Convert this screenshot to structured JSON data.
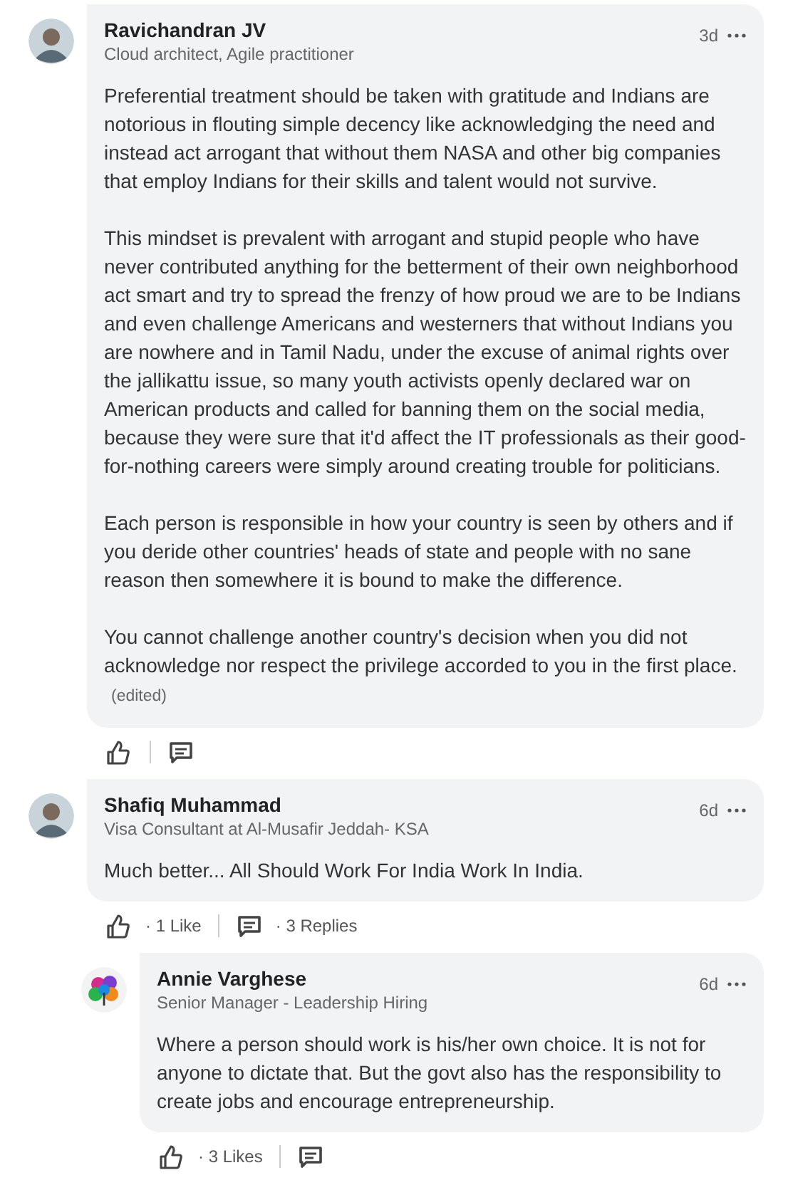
{
  "comments": [
    {
      "author": "Ravichandran JV",
      "headline": "Cloud architect, Agile practitioner",
      "time": "3d",
      "kind": "photo",
      "paragraphs": [
        "Preferential treatment should be taken with gratitude and Indians are notorious in flouting simple decency like acknowledging the need and instead act arrogant that without them NASA and other big companies that employ Indians for their skills and talent would not survive.",
        "This mindset is prevalent with arrogant and stupid people who have never contributed anything for the betterment of their own neighborhood act smart and try to spread the frenzy of how proud we are to be Indians and even challenge Americans and westerners that without Indians you are nowhere and in Tamil Nadu, under the excuse of animal rights over the jallikattu issue, so many youth activists openly declared war on American products and called for banning them on the social media, because they were sure that it'd affect the IT professionals as their good-for-nothing careers were simply around creating trouble for politicians.",
        "Each person is responsible in how your country is seen by others and if you deride other countries' heads of state and people with no sane reason then somewhere it is bound to make the difference.",
        "You cannot challenge another country's decision when you did not acknowledge nor respect the privilege accorded to you in the first place."
      ],
      "edited": "(edited)"
    },
    {
      "author": "Shafiq Muhammad",
      "headline": "Visa Consultant at Al-Musafir Jeddah- KSA",
      "time": "6d",
      "kind": "photo",
      "paragraphs": [
        "Much better... All Should Work For India Work In India."
      ],
      "likes": "· 1 Like",
      "replies": "· 3 Replies",
      "children": [
        {
          "author": "Annie Varghese",
          "headline": "Senior Manager - Leadership Hiring",
          "time": "6d",
          "kind": "art",
          "paragraphs": [
            "Where a person should work is his/her own choice. It is not for anyone to dictate that. But the govt also has the responsibility to create jobs and encourage entrepreneurship."
          ],
          "likes": "· 3 Likes"
        }
      ]
    }
  ]
}
